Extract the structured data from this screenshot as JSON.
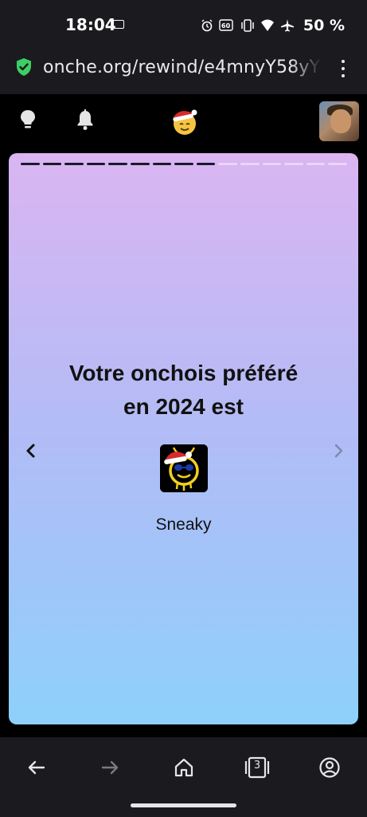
{
  "status_bar": {
    "time": "18:04",
    "battery": "50 %",
    "icons": [
      "gallery-icon",
      "alarm-icon",
      "volte-icon",
      "vibrate-icon",
      "wifi-icon",
      "airplane-icon"
    ]
  },
  "browser": {
    "url": "onche.org/rewind/e4mnyY58yY",
    "secure_icon": "shield-check-icon"
  },
  "site_header": {
    "icons": [
      "lightbulb-icon",
      "bell-icon",
      "santa-smiley-logo",
      "user-avatar"
    ]
  },
  "story": {
    "progress": {
      "total_segments": 15,
      "completed": 9
    },
    "title_line1": "Votre onchois préféré",
    "title_line2": "en 2024 est",
    "favorite_name": "Sneaky"
  },
  "bottom_nav": {
    "tab_count": "3",
    "icons": [
      "back-arrow-icon",
      "forward-arrow-icon",
      "home-icon",
      "tabs-icon",
      "account-icon"
    ]
  },
  "colors": {
    "card_top": "#dab5f2",
    "card_bottom": "#8ed0fb",
    "secure_green": "#3ecf63",
    "chrome_bg": "#1b1b1f"
  }
}
